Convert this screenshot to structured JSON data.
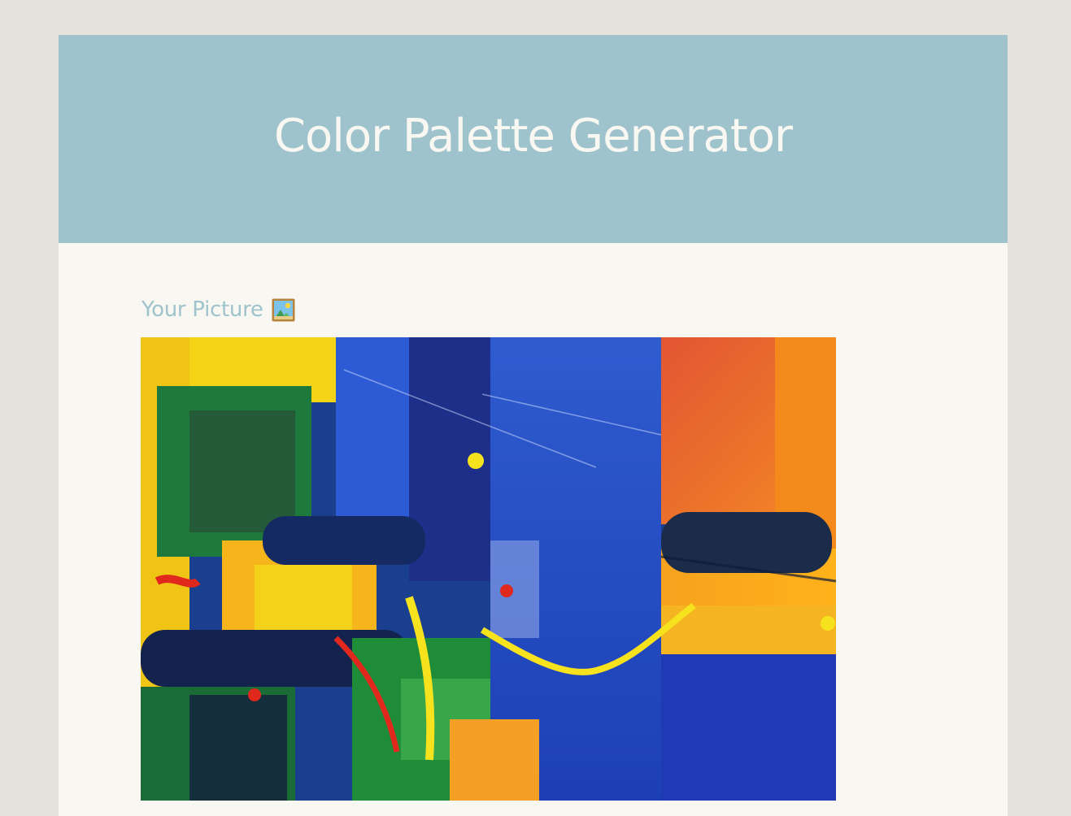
{
  "app": {
    "title": "Color Palette Generator"
  },
  "picture_section": {
    "heading": "Your Picture",
    "heading_icon": "framed-picture-icon",
    "image_description": "abstract-painting"
  },
  "colors": {
    "page_background": "#e5e1db",
    "card_background": "#f9f7f1",
    "header_background": "#9fc3cc",
    "title_text": "#f9f7f1",
    "heading_text": "#9fc3cc"
  }
}
